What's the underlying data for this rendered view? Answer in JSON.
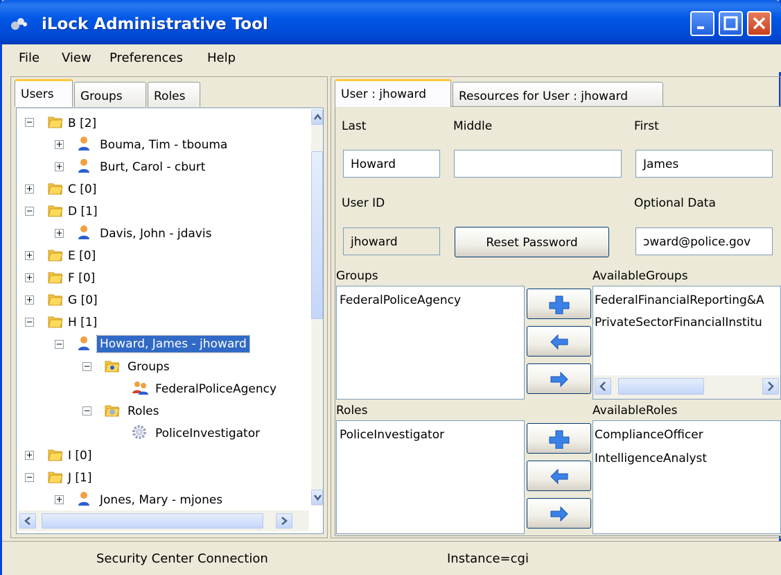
{
  "window": {
    "title": "iLock Administrative Tool"
  },
  "menu": {
    "file": "File",
    "view": "View",
    "preferences": "Preferences",
    "help": "Help"
  },
  "left_tabs": {
    "users": "Users",
    "groups": "Groups",
    "roles": "Roles"
  },
  "tree": {
    "b": "B [2]",
    "bouma": "Bouma, Tim  - tbouma",
    "burt": "Burt, Carol  - cburt",
    "c": "C [0]",
    "d": "D [1]",
    "davis": "Davis, John  - jdavis",
    "e": "E [0]",
    "f": "F [0]",
    "g": "G [0]",
    "h": "H [1]",
    "howard": "Howard, James  - jhoward",
    "groups": "Groups",
    "fpa": "FederalPoliceAgency",
    "roles": "Roles",
    "pi": "PoliceInvestigator",
    "i": "I [0]",
    "j": "J [1]",
    "jones": "Jones, Mary  - mjones"
  },
  "right_tabs": {
    "user": "User : jhoward",
    "resources": "Resources for User : jhoward"
  },
  "form": {
    "last_label": "Last",
    "middle_label": "Middle",
    "first_label": "First",
    "last_value": "Howard",
    "middle_value": "",
    "first_value": "James",
    "userid_label": "User ID",
    "optional_label": "Optional Data",
    "userid_value": "jhoward",
    "reset_label": "Reset Password",
    "optional_value": "ɔward@police.gov"
  },
  "groups": {
    "label": "Groups",
    "items": [
      "FederalPoliceAgency"
    ],
    "available_label": "AvailableGroups",
    "available": [
      "FederalFinancialReporting&A",
      "PrivateSectorFinancialInstitu"
    ]
  },
  "roles": {
    "label": "Roles",
    "items": [
      "PoliceInvestigator"
    ],
    "available_label": "AvailableRoles",
    "available": [
      "ComplianceOfficer",
      "IntelligenceAnalyst"
    ]
  },
  "status": {
    "connection": "Security Center Connection",
    "instance": "Instance=cgi"
  }
}
